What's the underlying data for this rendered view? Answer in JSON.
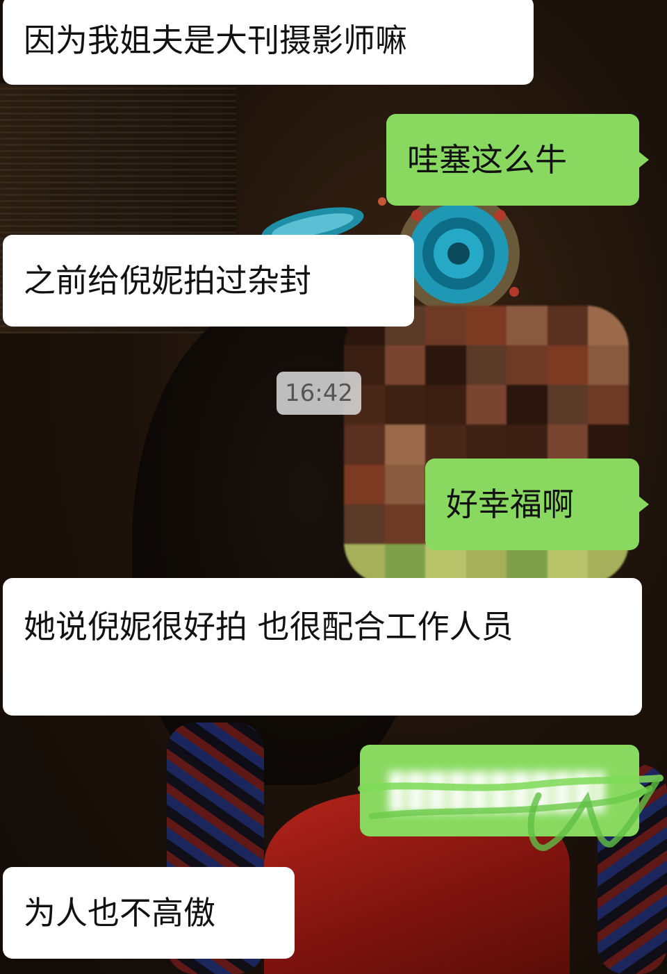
{
  "chat": {
    "timestamp": "16:42",
    "messages": [
      {
        "side": "in",
        "text": "因为我姐夫是大刊摄影师嘛"
      },
      {
        "side": "out",
        "text": "哇塞这么牛"
      },
      {
        "side": "in",
        "text": "之前给倪妮拍过杂封"
      },
      {
        "side": "out",
        "text": "好幸福啊"
      },
      {
        "side": "in",
        "text": "她说倪妮很好拍 也很配合工作人员"
      },
      {
        "side": "out",
        "text": "",
        "redacted": true
      },
      {
        "side": "in",
        "text": "为人也不高傲"
      }
    ]
  },
  "colors": {
    "incoming_bubble": "#ffffff",
    "outgoing_bubble": "#89d961",
    "timestamp_pill": "#d7d7d7"
  }
}
